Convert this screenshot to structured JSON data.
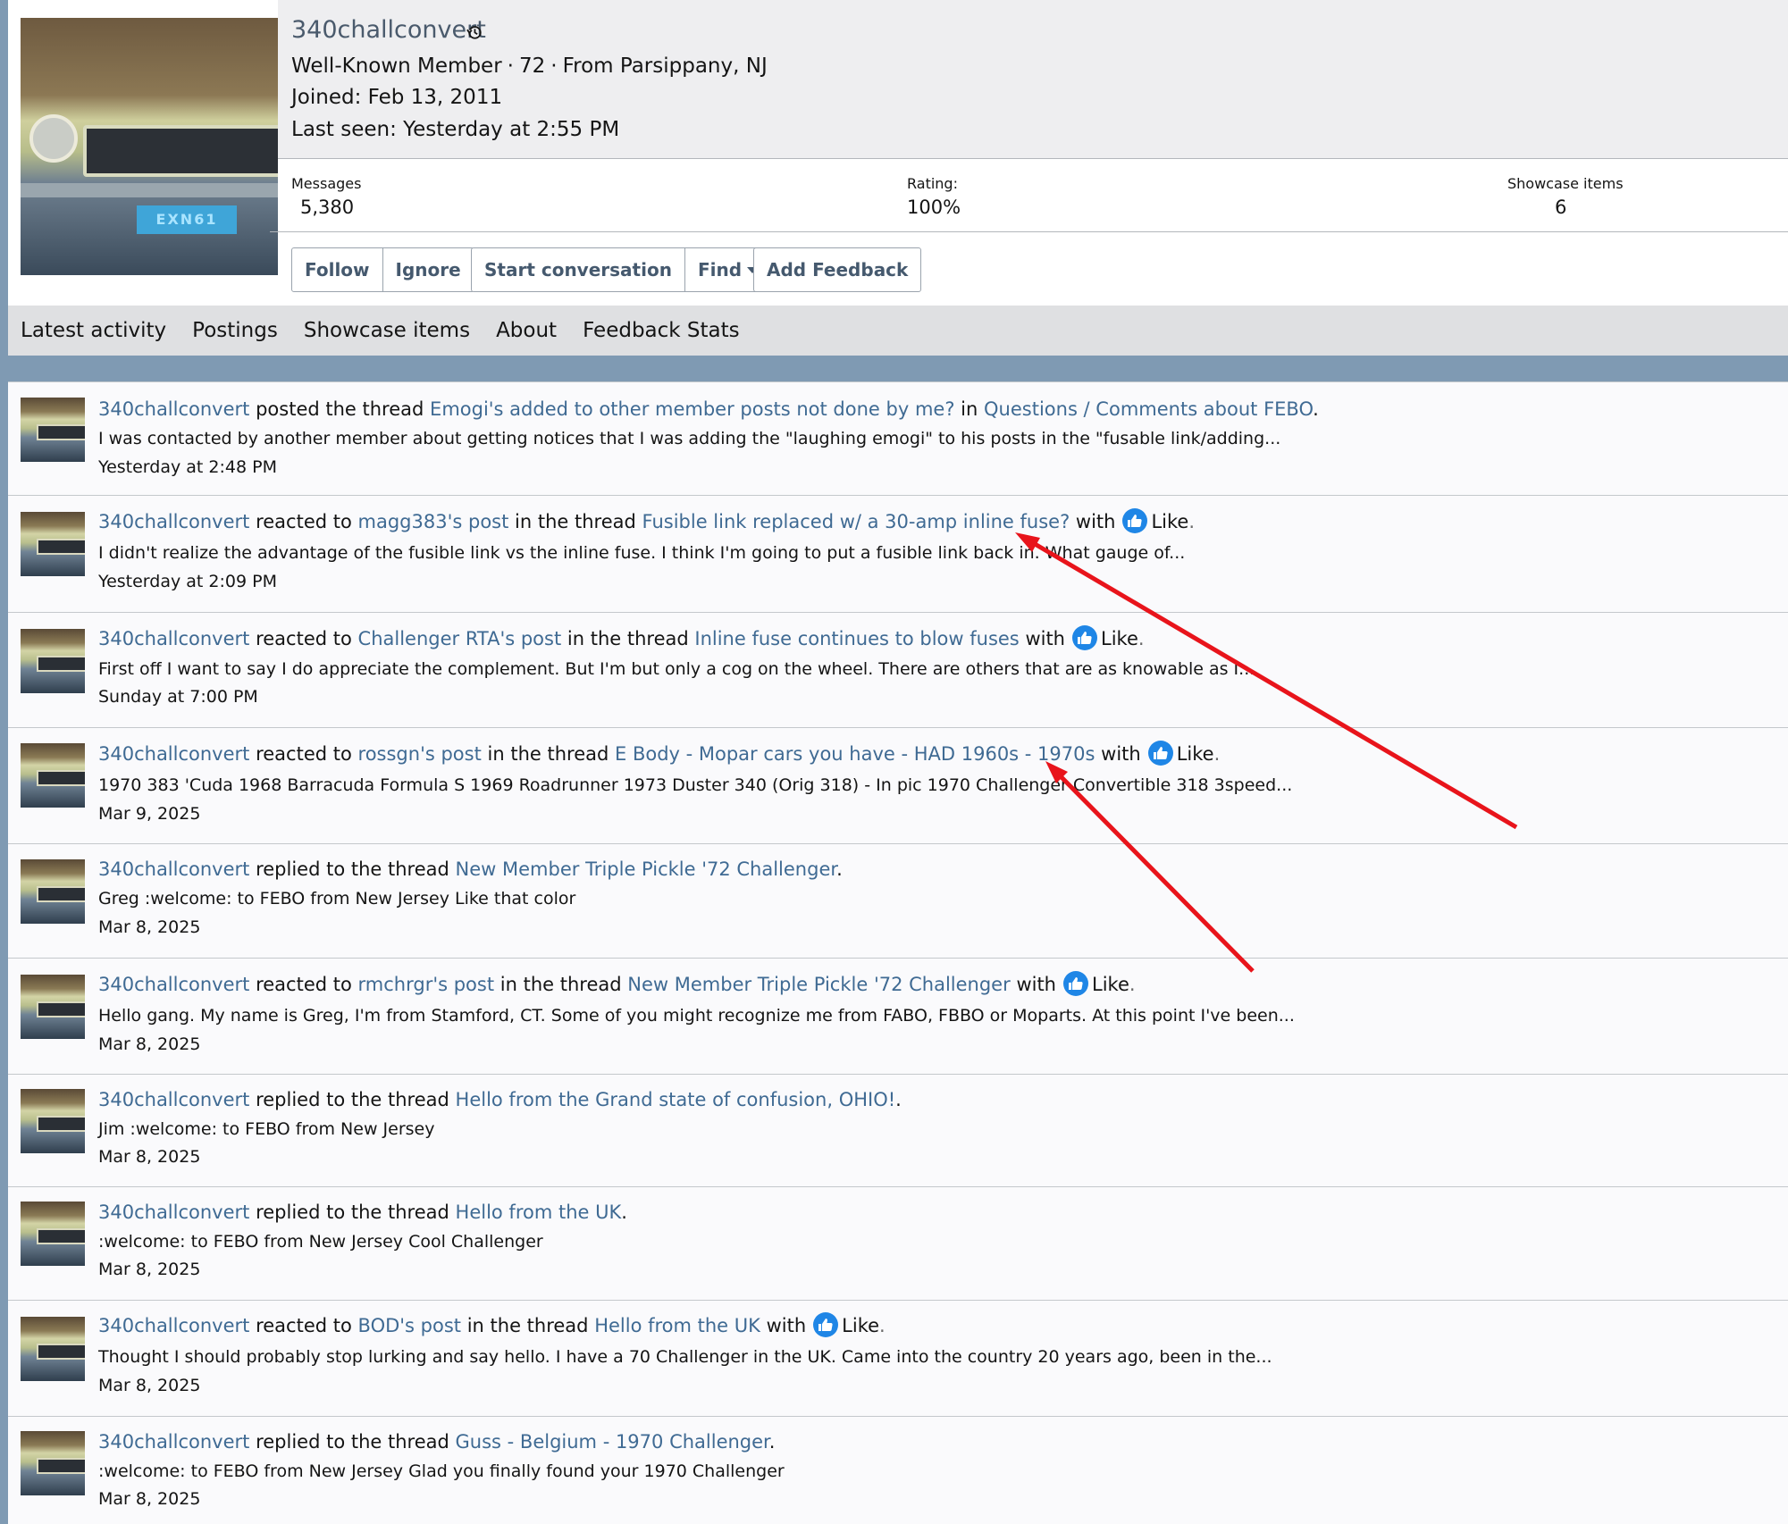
{
  "profile": {
    "username": "340challconvert",
    "role": "Well-Known Member",
    "age": "72",
    "location": "From Parsippany, NJ",
    "joined": "Joined: Feb 13, 2011",
    "last_seen": "Last seen: Yesterday at 2:55 PM",
    "plate_text": "EXN61",
    "stats": {
      "messages_label": "Messages",
      "messages_value": "5,380",
      "rating_label": "Rating:",
      "rating_value": "100%",
      "showcase_label": "Showcase items",
      "showcase_value": "6"
    },
    "buttons": {
      "follow": "Follow",
      "ignore": "Ignore",
      "start_conversation": "Start conversation",
      "find": "Find",
      "add_feedback": "Add Feedback"
    }
  },
  "tabs": [
    "Latest activity",
    "Postings",
    "Showcase items",
    "About",
    "Feedback Stats"
  ],
  "colors": {
    "link": "#3f6a93",
    "like": "#1f86e6",
    "annotation_arrow": "#e8141b",
    "background": "#7f9ab3"
  },
  "feed": [
    {
      "user": "340challconvert",
      "pre": "posted the thread",
      "thread": "Emogi's added to other member posts not done by me?",
      "mid": "in",
      "forum": "Questions / Comments about FEBO",
      "end": ".",
      "snippet": "I was contacted by another member about getting notices that I was adding the \"laughing emogi\" to his posts in the \"fusable link/adding...",
      "time": "Yesterday at 2:48 PM"
    },
    {
      "user": "340challconvert",
      "pre": "reacted to",
      "target": "magg383's post",
      "mid": "in the thread",
      "thread": "Fusible link replaced w/ a 30-amp inline fuse?",
      "with": "with",
      "reaction": "Like",
      "end": ".",
      "snippet": "I didn't realize the advantage of the fusible link vs the inline fuse. I think I'm going to put a fusible link back in. What gauge of...",
      "time": "Yesterday at 2:09 PM"
    },
    {
      "user": "340challconvert",
      "pre": "reacted to",
      "target": "Challenger RTA's post",
      "mid": "in the thread",
      "thread": "Inline fuse continues to blow fuses",
      "with": "with",
      "reaction": "Like",
      "end": ".",
      "snippet": "First off I want to say I do appreciate the complement. But I'm but only a cog on the wheel. There are others that are as knowable as I...",
      "time": "Sunday at 7:00 PM"
    },
    {
      "user": "340challconvert",
      "pre": "reacted to",
      "target": "rossgn's post",
      "mid": "in the thread",
      "thread": "E Body - Mopar cars you have - HAD 1960s - 1970s",
      "with": "with",
      "reaction": "Like",
      "end": ".",
      "snippet": "1970 383 'Cuda 1968 Barracuda Formula S 1969 Roadrunner 1973 Duster 340 (Orig 318) - In pic 1970 Challenger Convertible 318 3speed...",
      "time": "Mar 9, 2025"
    },
    {
      "user": "340challconvert",
      "pre": "replied to the thread",
      "thread": "New Member Triple Pickle '72 Challenger",
      "end": ".",
      "snippet": "Greg :welcome: to FEBO from New Jersey Like that color",
      "time": "Mar 8, 2025"
    },
    {
      "user": "340challconvert",
      "pre": "reacted to",
      "target": "rmchrgr's post",
      "mid": "in the thread",
      "thread": "New Member Triple Pickle '72 Challenger",
      "with": "with",
      "reaction": "Like",
      "end": ".",
      "snippet": "Hello gang. My name is Greg, I'm from Stamford, CT. Some of you might recognize me from FABO, FBBO or Moparts. At this point I've been...",
      "time": "Mar 8, 2025"
    },
    {
      "user": "340challconvert",
      "pre": "replied to the thread",
      "thread": "Hello from the Grand state of confusion, OHIO!",
      "end": ".",
      "snippet": "Jim :welcome: to FEBO from New Jersey",
      "time": "Mar 8, 2025"
    },
    {
      "user": "340challconvert",
      "pre": "replied to the thread",
      "thread": "Hello from the UK",
      "end": ".",
      "snippet": ":welcome: to FEBO from New Jersey Cool Challenger",
      "time": "Mar 8, 2025"
    },
    {
      "user": "340challconvert",
      "pre": "reacted to",
      "target": "BOD's post",
      "mid": "in the thread",
      "thread": "Hello from the UK",
      "with": "with",
      "reaction": "Like",
      "end": ".",
      "snippet": "Thought I should probably stop lurking and say hello. I have a 70 Challenger in the UK. Came into the country 20 years ago, been in the...",
      "time": "Mar 8, 2025"
    },
    {
      "user": "340challconvert",
      "pre": "replied to the thread",
      "thread": "Guss - Belgium - 1970 Challenger",
      "end": ".",
      "snippet": ":welcome: to FEBO from New Jersey Glad you finally found your 1970 Challenger",
      "time": "Mar 8, 2025"
    }
  ]
}
